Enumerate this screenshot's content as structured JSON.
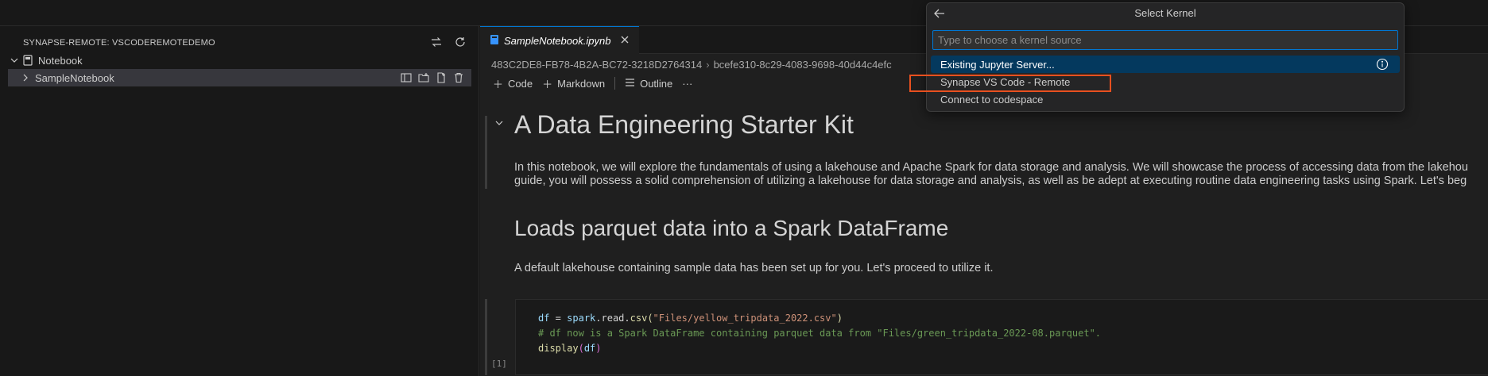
{
  "sidebar": {
    "title": "SYNAPSE-REMOTE: VSCODEREMOTEDEMO",
    "tree": [
      {
        "label": "Notebook",
        "expanded": true,
        "icon": "notebook-icon"
      },
      {
        "label": "SampleNotebook",
        "expanded": false,
        "selected": true
      }
    ],
    "actions": [
      "refresh-sync-icon",
      "refresh-icon"
    ],
    "row_actions": [
      "open-notebook-icon",
      "new-folder-icon",
      "new-file-icon",
      "trash-icon"
    ]
  },
  "editor": {
    "tab": {
      "label": "SampleNotebook.ipynb",
      "icon": "notebook-file-icon"
    },
    "breadcrumbs": [
      "483C2DE8-FB78-4B2A-BC72-3218D2764314",
      "bcefe310-8c29-4083-9698-40d44c4efc"
    ],
    "toolbar": {
      "code": "Code",
      "markdown": "Markdown",
      "outline": "Outline",
      "more": "···"
    },
    "heading1": "A Data Engineering Starter Kit",
    "paragraph1_line1": "In this notebook, we will explore the fundamentals of using a lakehouse and Apache Spark for data storage and analysis. We will showcase the process of accessing data from the lakehou",
    "paragraph1_line2": "guide, you will possess a solid comprehension of utilizing a lakehouse for data storage and analysis, as well as be adept at executing routine data engineering tasks using Spark. Let's beg",
    "heading2": "Loads parquet data into a Spark DataFrame",
    "paragraph2": "A default lakehouse containing sample data has been set up for you. Let's proceed to utilize it.",
    "code_lines": {
      "line1_var": "df",
      "line1_eq": " = ",
      "line1_obj": "spark",
      "line1_dot": ".read.",
      "line1_fn": "csv",
      "line1_open": "(",
      "line1_str": "\"Files/yellow_tripdata_2022.csv\"",
      "line1_close": ")",
      "line2_comment": "# df now is a Spark DataFrame containing parquet data from \"Files/green_tripdata_2022-08.parquet\".",
      "line3_fn": "display",
      "line3_open": "(",
      "line3_arg": "df",
      "line3_close": ")"
    },
    "exec_count": "[1]"
  },
  "quickpick": {
    "title": "Select Kernel",
    "placeholder": "Type to choose a kernel source",
    "items": [
      {
        "label": "Existing Jupyter Server...",
        "active": true
      },
      {
        "label": "Synapse VS Code - Remote",
        "highlighted": true
      },
      {
        "label": "Connect to codespace"
      }
    ]
  },
  "colors": {
    "accent": "#0078d4",
    "highlight": "#e8501f",
    "active_item": "#04395e"
  }
}
